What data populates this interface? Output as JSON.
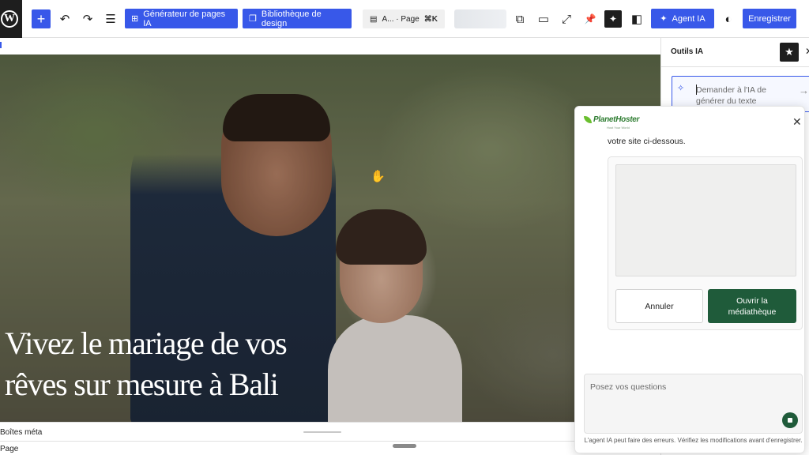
{
  "toolbar": {
    "add_symbol": "+",
    "undo_icon": "↶",
    "redo_icon": "↷",
    "list_view_icon": "☰",
    "ai_page_generator": "Générateur de pages IA",
    "design_library": "Bibliothèque de design",
    "doc_title": "A... · Page",
    "shortcut": "⌘K",
    "external_icon": "⧉",
    "preview_icon": "▭",
    "fullscreen_icon": "⤢",
    "pin_icon": "📌",
    "sparkle_icon": "✦",
    "sidebar_icon": "◧",
    "agent_ia": "Agent IA",
    "contrast_icon": "◐",
    "save": "Enregistrer",
    "accent": "#3858e9"
  },
  "hero": {
    "title_line1": "Vivez le mariage de vos",
    "title_line2": "rêves sur mesure à Bali",
    "cursor": "✋"
  },
  "bottom": {
    "meta_label": "Boîtes méta",
    "page_label": "Page"
  },
  "sidebar": {
    "title": "Outils IA",
    "star": "★",
    "close": "✕",
    "ai_prompt_placeholder": "Demander à l'IA de générer du texte",
    "sparkle": "✧",
    "arrow": "→"
  },
  "popup": {
    "brand_name": "PlanetHoster",
    "brand_tagline": "Host Your World",
    "close": "✕",
    "intro": "votre site ci-dessous.",
    "cancel": "Annuler",
    "open_library": "Ouvrir la médiathèque",
    "ask_placeholder": "Posez vos questions",
    "disclaimer": "L'agent IA peut faire des erreurs. Vérifiez les modifications avant d'enregistrer.",
    "brand_color": "#1f5b3a"
  }
}
